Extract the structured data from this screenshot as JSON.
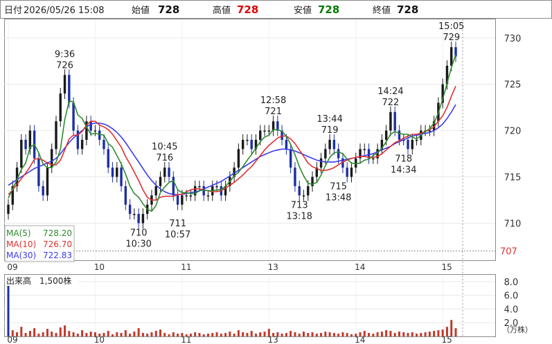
{
  "header": {
    "date_label": "日付",
    "date_value": "2026/05/26 15:08",
    "open_label": "始値",
    "open_value": "728",
    "high_label": "高値",
    "high_value": "728",
    "low_label": "安値",
    "low_value": "728",
    "close_label": "終値",
    "close_value": "728"
  },
  "colors": {
    "up": "#1a1a1a",
    "down": "#1c2fa6",
    "ma5": "#2e8b2e",
    "ma10": "#e03030",
    "ma30": "#3a3af0",
    "high": "#e00000",
    "low": "#007a00",
    "volume": "#c0392b"
  },
  "legend": [
    {
      "label": "MA(5)",
      "value": "728.20",
      "color": "#2e8b2e"
    },
    {
      "label": "MA(10)",
      "value": "726.70",
      "color": "#e03030"
    },
    {
      "label": "MA(30)",
      "value": "722.83",
      "color": "#3a3af0"
    }
  ],
  "volume_label": "出来高　1,500株",
  "volume_unit": "（万株）",
  "current_price_label": "707",
  "chart_data": {
    "type": "candlestick",
    "price_axis": {
      "ylim": [
        706,
        732
      ],
      "ticks": [
        710,
        715,
        720,
        725,
        730
      ]
    },
    "volume_axis": {
      "ylim": [
        0,
        9
      ],
      "ticks": [
        "2.0",
        "4.0",
        "6.0",
        "8.0"
      ],
      "unit": "万株"
    },
    "x_ticks": [
      "09",
      "10",
      "11",
      "13",
      "14",
      "15"
    ],
    "x_tick_index": [
      0,
      20,
      40,
      60,
      80,
      100
    ],
    "annotations": [
      {
        "index": 13,
        "time": "9:36",
        "price": 726,
        "pos": "above"
      },
      {
        "index": 30,
        "time": "10:30",
        "price": 710,
        "pos": "below"
      },
      {
        "index": 36,
        "time": "10:45",
        "price": 716,
        "pos": "above"
      },
      {
        "index": 39,
        "time": "10:57",
        "price": 711,
        "pos": "below"
      },
      {
        "index": 61,
        "time": "12:58",
        "price": 721,
        "pos": "above"
      },
      {
        "index": 67,
        "time": "13:18",
        "price": 713,
        "pos": "below"
      },
      {
        "index": 74,
        "time": "13:44",
        "price": 719,
        "pos": "above"
      },
      {
        "index": 76,
        "time": "13:48",
        "price": 715,
        "pos": "below"
      },
      {
        "index": 88,
        "time": "14:24",
        "price": 722,
        "pos": "above"
      },
      {
        "index": 91,
        "time": "14:34",
        "price": 718,
        "pos": "below"
      },
      {
        "index": 102,
        "time": "15:05",
        "price": 729,
        "pos": "above"
      }
    ],
    "close": [
      712,
      714,
      716,
      719,
      718,
      720,
      717,
      714,
      713,
      716,
      718,
      721,
      724,
      726,
      723,
      720,
      718,
      719,
      721,
      720,
      720,
      719,
      718,
      716,
      715,
      716,
      714,
      712,
      711,
      711,
      710,
      711,
      712,
      713,
      714,
      715,
      716,
      715,
      713,
      712,
      713,
      713,
      713,
      714,
      714,
      713,
      713,
      714,
      714,
      713,
      714,
      715,
      716,
      718,
      719,
      719,
      718,
      719,
      720,
      720,
      720,
      721,
      720,
      719,
      718,
      716,
      714,
      713,
      713,
      714,
      715,
      716,
      717,
      718,
      719,
      718,
      717,
      716,
      715,
      716,
      717,
      718,
      718,
      717,
      717,
      718,
      719,
      720,
      722,
      720,
      719,
      719,
      718,
      719,
      719,
      720,
      720,
      720,
      721,
      723,
      725,
      727,
      729,
      728
    ],
    "ma5": [
      712.7,
      713.7,
      714.7,
      715.8,
      716.5,
      718.2,
      718.5,
      717.6,
      716.4,
      716,
      716,
      716.6,
      718,
      721.2,
      723.2,
      723.1,
      721.7,
      721.3,
      720.4,
      719.6,
      719.7,
      719.6,
      719.5,
      718.6,
      718.2,
      717.3,
      716.4,
      715.3,
      714,
      713.2,
      712.8,
      712.1,
      711.5,
      711.3,
      711.9,
      713.3,
      713.9,
      714.4,
      714.6,
      713.6,
      713.3,
      713.3,
      713.2,
      713.2,
      713.5,
      713.6,
      713.5,
      713.5,
      713.6,
      713.6,
      714,
      714.5,
      715.1,
      715.5,
      716.1,
      716.8,
      717.4,
      718.1,
      718.8,
      719.3,
      719.5,
      720.1,
      720.1,
      719.9,
      719.4,
      718.5,
      717.4,
      716.1,
      715.1,
      714.3,
      714.2,
      714.4,
      715.2,
      716.2,
      717.1,
      717.6,
      717.7,
      717.5,
      716.9,
      716.5,
      716.4,
      716.5,
      716.8,
      716.9,
      717.3,
      717.6,
      718.1,
      718.8,
      719.6,
      719.9,
      719.7,
      719.6,
      719.6,
      719.3,
      719.1,
      719.5,
      719.9,
      720.2,
      720.8,
      721.9,
      723.4,
      725.1,
      726.8,
      728.2
    ],
    "ma10": [
      713.1,
      713.6,
      714.2,
      714.8,
      715.4,
      716.1,
      716.9,
      717,
      716.8,
      716.5,
      716.3,
      716.3,
      716.8,
      717.9,
      719.1,
      719.5,
      719.5,
      719.9,
      720.6,
      721,
      721,
      720.6,
      720.4,
      720.1,
      719.6,
      718.9,
      718.2,
      717.2,
      716.4,
      715.5,
      714.6,
      713.6,
      712.8,
      712.5,
      712.5,
      712.8,
      712.9,
      712.9,
      712.9,
      713.1,
      713.1,
      713.4,
      713.6,
      713.7,
      713.7,
      713.6,
      713.5,
      713.4,
      713.4,
      713.5,
      713.8,
      714.1,
      714.4,
      714.8,
      715.2,
      715.7,
      716.1,
      716.7,
      717.3,
      717.9,
      718.4,
      718.8,
      719.2,
      719.4,
      719.4,
      719.1,
      718.6,
      717.9,
      717.2,
      716.5,
      716.1,
      715.9,
      715.7,
      715.7,
      715.8,
      716,
      716.3,
      716.6,
      716.8,
      717,
      717.1,
      717.2,
      717.2,
      717.1,
      717.1,
      717.2,
      717.5,
      717.9,
      718.3,
      718.7,
      718.9,
      719.2,
      719.4,
      719.6,
      719.6,
      719.7,
      719.9,
      720.1,
      720.4,
      721,
      721.6,
      722.5,
      723.7,
      724.8
    ],
    "ma30": [
      714.1,
      714.4,
      714.7,
      715,
      715.3,
      715.6,
      715.9,
      716.1,
      716.3,
      716.5,
      716.7,
      717,
      717.5,
      718.1,
      718.7,
      719.2,
      719.6,
      720,
      720.4,
      720.7,
      720.8,
      720.8,
      720.7,
      720.5,
      720.2,
      719.8,
      719.3,
      718.7,
      718,
      717.3,
      716.6,
      715.9,
      715.2,
      714.6,
      714.1,
      713.7,
      713.4,
      713.2,
      713.1,
      713.1,
      713.1,
      713.2,
      713.3,
      713.4,
      713.5,
      713.7,
      713.9,
      714.1,
      714.3,
      714.5,
      714.8,
      715.1,
      715.4,
      715.7,
      716,
      716.3,
      716.6,
      716.9,
      717.2,
      717.4,
      717.6,
      717.8,
      717.9,
      718,
      718,
      717.9,
      717.8,
      717.6,
      717.4,
      717.2,
      717,
      716.8,
      716.7,
      716.6,
      716.6,
      716.6,
      716.7,
      716.8,
      716.9,
      717,
      717.1,
      717.2,
      717.3,
      717.4,
      717.5,
      717.7,
      717.9,
      718.1,
      718.3,
      718.6,
      718.8,
      719,
      719.2,
      719.4,
      719.5,
      719.6,
      719.7,
      719.8,
      720,
      720.3,
      720.7,
      721.3,
      722,
      722.8
    ],
    "volume": [
      8.7,
      0.9,
      0.6,
      1.4,
      0.5,
      0.8,
      1.2,
      0.4,
      0.6,
      1.1,
      0.7,
      0.5,
      1.3,
      1.6,
      0.8,
      0.6,
      0.4,
      0.9,
      0.5,
      0.7,
      0.6,
      0.4,
      0.5,
      0.8,
      0.3,
      0.6,
      0.5,
      0.9,
      0.4,
      0.7,
      1.2,
      0.5,
      0.4,
      0.6,
      0.8,
      1.0,
      0.5,
      0.3,
      0.6,
      0.4,
      0.5,
      0.3,
      0.4,
      0.6,
      0.5,
      0.3,
      0.4,
      0.5,
      0.6,
      0.4,
      0.5,
      0.7,
      0.4,
      0.9,
      0.6,
      0.5,
      0.8,
      0.4,
      0.6,
      0.7,
      1.1,
      0.5,
      0.6,
      0.4,
      0.5,
      0.8,
      0.6,
      0.4,
      0.7,
      0.5,
      0.6,
      0.4,
      0.5,
      0.7,
      0.6,
      0.5,
      0.4,
      0.6,
      0.5,
      0.3,
      0.4,
      0.6,
      0.8,
      0.5,
      0.4,
      0.6,
      0.7,
      0.9,
      0.8,
      0.5,
      0.7,
      0.6,
      0.5,
      0.6,
      0.4,
      0.5,
      0.6,
      0.7,
      0.8,
      0.9,
      1.0,
      1.4,
      2.4,
      1.2
    ]
  }
}
